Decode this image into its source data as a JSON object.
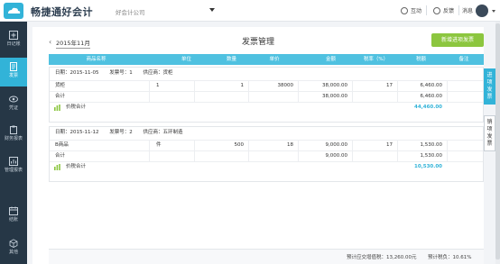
{
  "header": {
    "brand": "畅捷通好会计",
    "company": "好会计公司",
    "items": [
      {
        "label": "互动",
        "icon": "headset-icon"
      },
      {
        "label": "反馈",
        "icon": "feedback-icon"
      },
      {
        "label": "消息",
        "icon": "bell-icon"
      }
    ]
  },
  "sidebar": {
    "items": [
      {
        "label": "日记账",
        "icon": "plus-box-icon",
        "active": false
      },
      {
        "label": "发票",
        "icon": "document-icon",
        "active": true
      },
      {
        "label": "凭证",
        "icon": "eye-icon",
        "active": false
      },
      {
        "label": "财务报表",
        "icon": "clipboard-icon",
        "active": false
      },
      {
        "label": "管理报表",
        "icon": "chart-icon",
        "active": false
      },
      {
        "label": "结账",
        "icon": "calendar-icon",
        "active": false
      },
      {
        "label": "其他",
        "icon": "cube-icon",
        "active": false
      }
    ]
  },
  "main": {
    "period": "2015年11月",
    "title": "发票管理",
    "new_button": "新增进项发票",
    "columns": [
      "商品名称",
      "单位",
      "数量",
      "单价",
      "金额",
      "税率（%）",
      "税额",
      "备注"
    ],
    "invoices": [
      {
        "date": "日期：2015-11-05",
        "number": "发票号：1",
        "supplier": "供应商：货柜",
        "rows": [
          {
            "name": "货柜",
            "unit": "1",
            "qty": "1",
            "price": "38000",
            "amount": "38,000.00",
            "rate": "17",
            "tax": "6,460.00",
            "note": ""
          },
          {
            "name": "合计",
            "unit": "",
            "qty": "",
            "price": "",
            "amount": "38,000.00",
            "rate": "",
            "tax": "6,460.00",
            "note": ""
          }
        ],
        "total_label": "价税合计",
        "total_value": "44,460.00"
      },
      {
        "date": "日期：2015-11-12",
        "number": "发票号：2",
        "supplier": "供应商：五环制造",
        "rows": [
          {
            "name": "B商品",
            "unit": "件",
            "qty": "500",
            "price": "18",
            "amount": "9,000.00",
            "rate": "17",
            "tax": "1,530.00",
            "note": ""
          },
          {
            "name": "合计",
            "unit": "",
            "qty": "",
            "price": "",
            "amount": "9,000.00",
            "rate": "",
            "tax": "1,530.00",
            "note": ""
          }
        ],
        "total_label": "价税合计",
        "total_value": "10,530.00"
      }
    ],
    "footer": {
      "vat_label": "预计应交增值税：13,260.00元",
      "burden_label": "预计税负：10.61%"
    }
  },
  "right_tabs": [
    {
      "label": "进项发票",
      "active": true
    },
    {
      "label": "销项发票",
      "active": false
    }
  ],
  "colors": {
    "accent": "#32b3d8",
    "sidebar": "#263746",
    "green": "#8cc63f"
  }
}
